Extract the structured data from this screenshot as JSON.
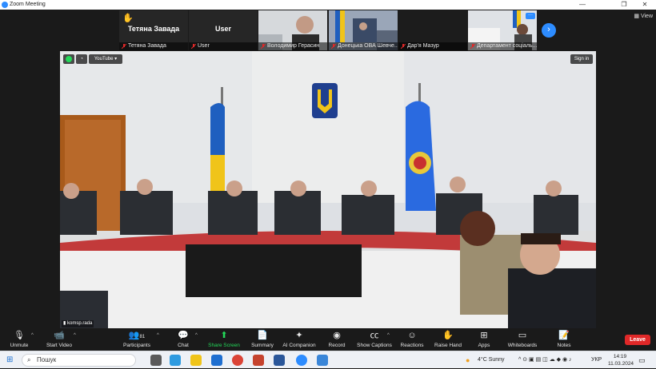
{
  "window": {
    "title": "Zoom Meeting"
  },
  "top_strip": {
    "participants": [
      {
        "name": "Тетяна Завада",
        "display": "Тетяна Завада",
        "raised_hand": true
      },
      {
        "name": "User",
        "display": "User"
      },
      {
        "name": "Володимир Герасин"
      },
      {
        "name": "Донецька ОВА Шевче..."
      },
      {
        "name": "Дар'я Мазур"
      },
      {
        "name": "Департамент соціаль..."
      }
    ],
    "view_label": "View"
  },
  "main_video": {
    "source": "YouTube",
    "sign_in": "Sign in",
    "speaker": "komsp.rada"
  },
  "toolbar": {
    "unmute": "Unmute",
    "start_video": "Start Video",
    "participants": "Participants",
    "participants_count": "81",
    "chat": "Chat",
    "share_screen": "Share Screen",
    "summary": "Summary",
    "ai_companion": "AI Companion",
    "record": "Record",
    "show_captions": "Show Captions",
    "reactions": "Reactions",
    "raise_hand": "Raise Hand",
    "apps": "Apps",
    "whiteboards": "Whiteboards",
    "notes": "Notes",
    "leave": "Leave"
  },
  "taskbar": {
    "search_placeholder": "Пошук",
    "weather": "4°C  Sunny",
    "language": "УКР",
    "time": "14:19",
    "date": "11.03.2024"
  },
  "colors": {
    "accent": "#2d8cff",
    "leave": "#e02828",
    "share": "#23d959"
  }
}
